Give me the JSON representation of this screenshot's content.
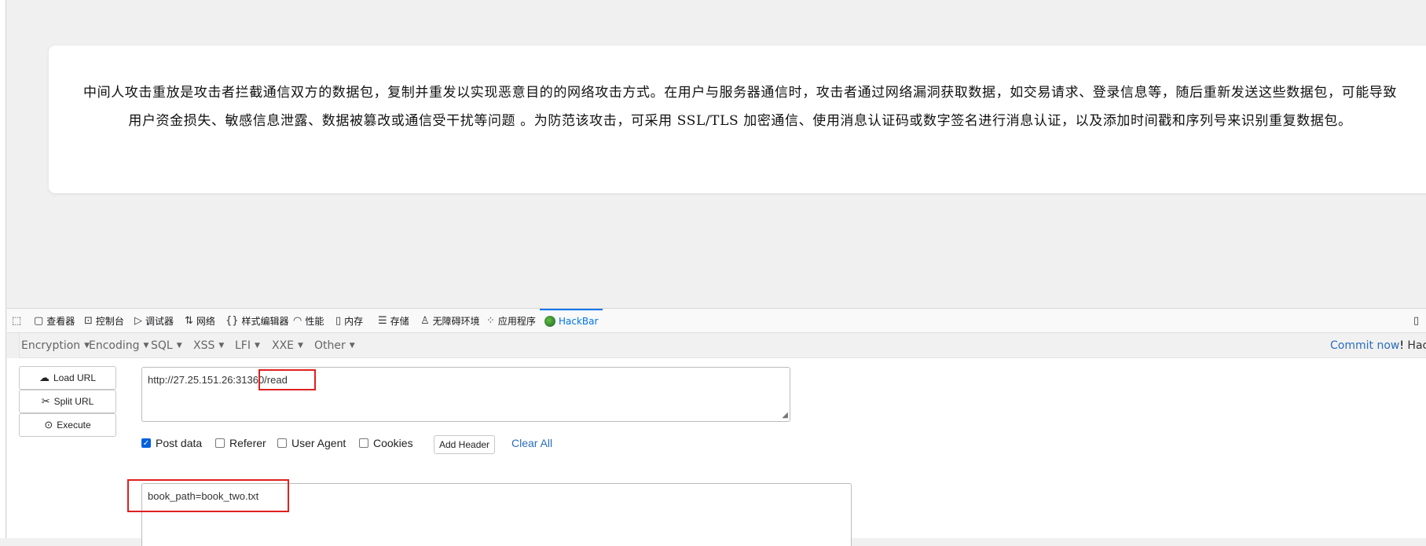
{
  "content": {
    "paragraph": "中间人攻击重放是攻击者拦截通信双方的数据包，复制并重发以实现恶意目的的网络攻击方式。在用户与服务器通信时，攻击者通过网络漏洞获取数据，如交易请求、登录信息等，随后重新发送这些数据包，可能导致用户资金损失、敏感信息泄露、数据被篡改或通信受干扰等问题 。为防范该攻击，可采用 SSL/TLS 加密通信、使用消息认证码或数字签名进行消息认证，以及添加时间戳和序列号来识别重复数据包。"
  },
  "devtools": {
    "tabs": [
      {
        "label": "查看器",
        "icon": "inspector-icon"
      },
      {
        "label": "控制台",
        "icon": "console-icon"
      },
      {
        "label": "调试器",
        "icon": "debugger-icon"
      },
      {
        "label": "网络",
        "icon": "network-icon"
      },
      {
        "label": "样式编辑器",
        "icon": "style-editor-icon"
      },
      {
        "label": "性能",
        "icon": "performance-icon"
      },
      {
        "label": "内存",
        "icon": "memory-icon"
      },
      {
        "label": "存储",
        "icon": "storage-icon"
      },
      {
        "label": "无障碍环境",
        "icon": "accessibility-icon"
      },
      {
        "label": "应用程序",
        "icon": "application-icon"
      },
      {
        "label": "HackBar",
        "icon": "hackbar-logo-icon",
        "active": true
      }
    ]
  },
  "hackbar": {
    "menu": [
      "Encryption",
      "Encoding",
      "SQL",
      "XSS",
      "LFI",
      "XXE",
      "Other"
    ],
    "commit_link": "Commit now",
    "commit_excl": "!",
    "commit_tail": "Hack",
    "buttons": {
      "load": "Load URL",
      "split": "Split URL",
      "execute": "Execute"
    },
    "url_value": "http://27.25.151.26:31360/read",
    "options": {
      "post_data": "Post data",
      "referer": "Referer",
      "user_agent": "User Agent",
      "cookies": "Cookies",
      "add_header": "Add Header",
      "clear_all": "Clear All"
    },
    "post_body": "book_path=book_two.txt"
  }
}
